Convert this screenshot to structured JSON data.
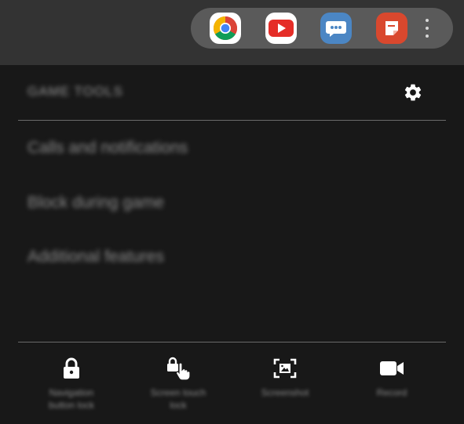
{
  "app_bar": {
    "apps": [
      {
        "name": "Chrome",
        "icon": "chrome-icon"
      },
      {
        "name": "YouTube",
        "icon": "youtube-icon"
      },
      {
        "name": "Messages",
        "icon": "messages-icon"
      },
      {
        "name": "Notes",
        "icon": "notes-icon"
      }
    ],
    "more_icon": "more-vertical-icon"
  },
  "panel": {
    "title": "GAME TOOLS",
    "settings_icon": "gear-icon",
    "menu": [
      "Calls and notifications",
      "Block during game",
      "Additional features"
    ],
    "tools": [
      {
        "label_line1": "Navigation",
        "label_line2": "button lock",
        "icon": "lock-icon"
      },
      {
        "label_line1": "Screen touch",
        "label_line2": "lock",
        "icon": "touch-lock-icon"
      },
      {
        "label_line1": "Screenshot",
        "label_line2": "",
        "icon": "screenshot-icon"
      },
      {
        "label_line1": "Record",
        "label_line2": "",
        "icon": "video-record-icon"
      }
    ]
  },
  "colors": {
    "background": "#181818",
    "top_strip": "#333333",
    "app_bar": "#5a5a5a",
    "divider": "#6a6a6a",
    "icon_white": "#ffffff",
    "youtube_red": "#e52d27",
    "messages_blue": "#4b86c4",
    "notes_red": "#d9482e"
  }
}
